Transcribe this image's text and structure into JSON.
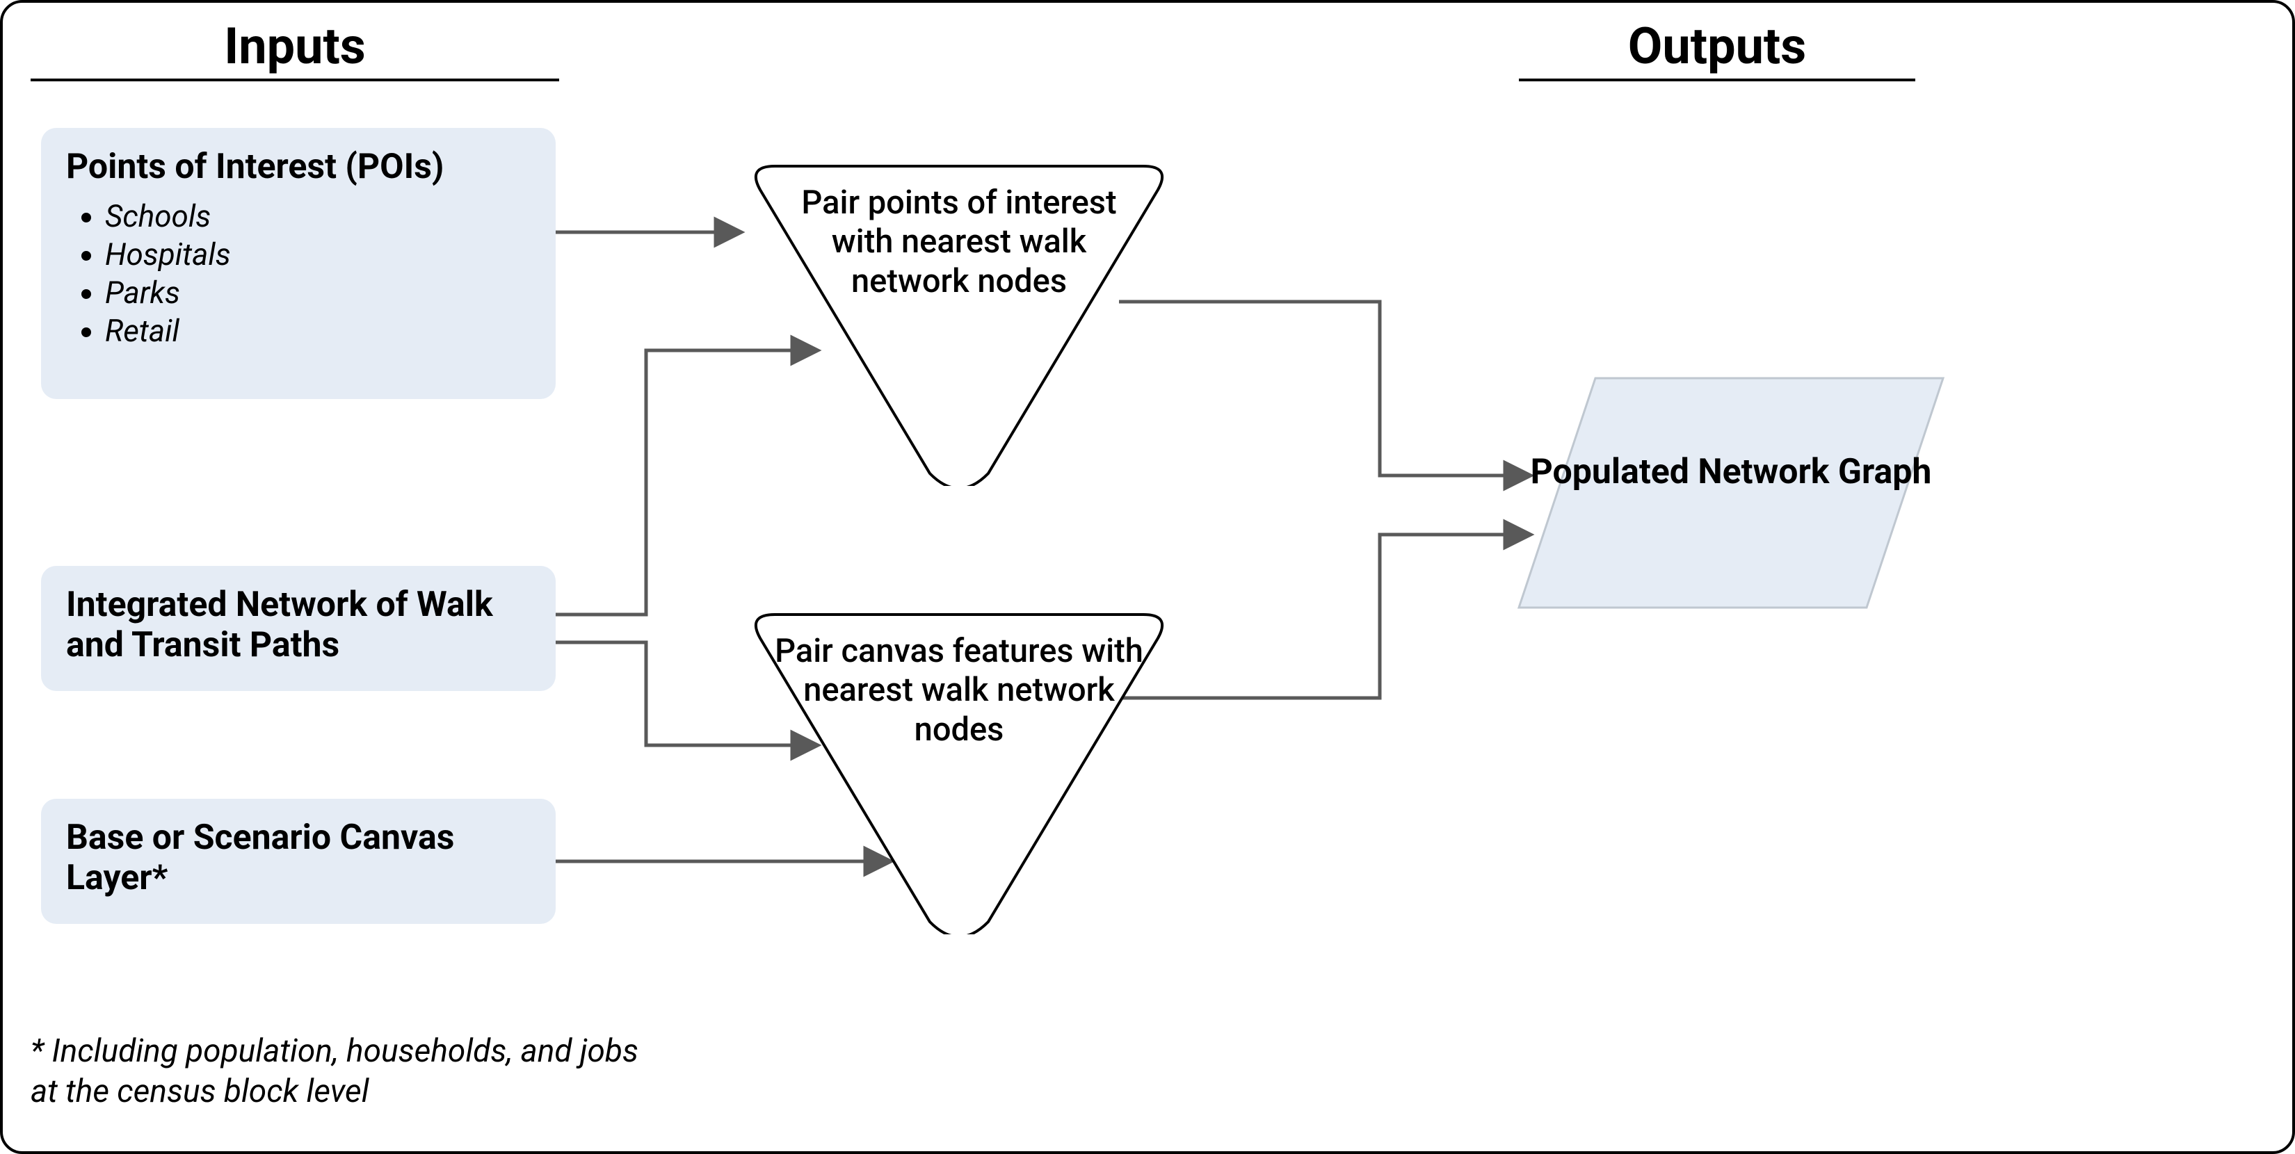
{
  "headers": {
    "inputs": "Inputs",
    "outputs": "Outputs"
  },
  "inputs": {
    "poi": {
      "title": "Points of Interest (POIs)",
      "items": [
        "Schools",
        "Hospitals",
        "Parks",
        "Retail"
      ]
    },
    "network": {
      "title": "Integrated Network of Walk and Transit Paths"
    },
    "canvas": {
      "title": "Base or Scenario Canvas Layer*"
    }
  },
  "processes": {
    "pair_poi": "Pair points of interest with nearest walk network nodes",
    "pair_canvas": "Pair canvas features with nearest walk network nodes"
  },
  "output": {
    "title": "Populated Network Graph"
  },
  "footnote": "* Including population, households, and jobs at the census block level",
  "colors": {
    "box_fill": "#e5ecf5",
    "arrow": "#595959",
    "border": "#000000"
  }
}
